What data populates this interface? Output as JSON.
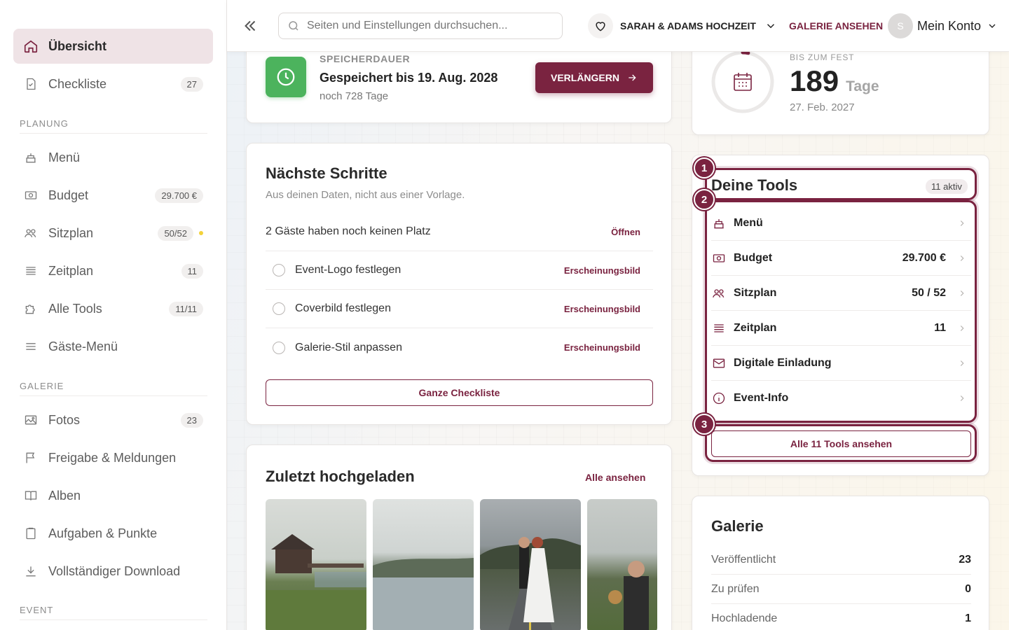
{
  "sidebar": {
    "items": [
      {
        "label": "Übersicht",
        "icon": "home-icon"
      },
      {
        "label": "Checkliste",
        "badge": "27",
        "icon": "checklist-icon"
      },
      {
        "label": "Menü",
        "icon": "cake-icon"
      },
      {
        "label": "Budget",
        "badge": "29.700 €",
        "icon": "money-icon"
      },
      {
        "label": "Sitzplan",
        "badge": "50/52",
        "icon": "people-icon"
      },
      {
        "label": "Zeitplan",
        "badge": "11",
        "icon": "timeline-icon"
      },
      {
        "label": "Alle Tools",
        "badge": "11/11",
        "icon": "puzzle-icon"
      },
      {
        "label": "Gäste-Menü",
        "icon": "menu-lines-icon"
      },
      {
        "label": "Fotos",
        "badge": "23",
        "icon": "image-icon"
      },
      {
        "label": "Freigabe & Meldungen",
        "icon": "flag-icon"
      },
      {
        "label": "Alben",
        "icon": "book-icon"
      },
      {
        "label": "Aufgaben & Punkte",
        "icon": "clipboard-icon"
      },
      {
        "label": "Vollständiger Download",
        "icon": "download-icon"
      }
    ],
    "sections": {
      "planung": "PLANUNG",
      "galerie": "GALERIE",
      "event": "EVENT"
    }
  },
  "topbar": {
    "search_placeholder": "Seiten und Einstellungen durchsuchen...",
    "event_name": "SARAH & ADAMS HOCHZEIT",
    "gallery_link": "GALERIE ANSEHEN",
    "avatar_initial": "S",
    "account_label": "Mein Konto"
  },
  "storage": {
    "label": "SPEICHERDAUER",
    "title": "Gespeichert bis 19. Aug. 2028",
    "subtitle": "noch 728 Tage",
    "button": "VERLÄNGERN"
  },
  "countdown": {
    "label": "BIS ZUM FEST",
    "days": "189",
    "unit": "Tage",
    "date": "27. Feb. 2027",
    "progress": 0.03
  },
  "next_steps": {
    "title": "Nächste Schritte",
    "subtitle": "Aus deinen Daten, nicht aus einer Vorlage.",
    "alert": {
      "text": "2 Gäste haben noch keinen Platz",
      "action": "Öffnen"
    },
    "items": [
      {
        "text": "Event-Logo festlegen",
        "tag": "Erscheinungsbild"
      },
      {
        "text": "Coverbild festlegen",
        "tag": "Erscheinungsbild"
      },
      {
        "text": "Galerie-Stil anpassen",
        "tag": "Erscheinungsbild"
      }
    ],
    "button": "Ganze Checkliste"
  },
  "recent": {
    "title": "Zuletzt hochgeladen",
    "link": "Alle ansehen"
  },
  "tools": {
    "title": "Deine Tools",
    "badge": "11 aktiv",
    "items": [
      {
        "label": "Menü",
        "value": "",
        "icon": "cake-icon"
      },
      {
        "label": "Budget",
        "value": "29.700 €",
        "icon": "money-icon"
      },
      {
        "label": "Sitzplan",
        "value": "50 / 52",
        "icon": "people-icon"
      },
      {
        "label": "Zeitplan",
        "value": "11",
        "icon": "timeline-icon"
      },
      {
        "label": "Digitale Einladung",
        "value": "",
        "icon": "envelope-icon"
      },
      {
        "label": "Event-Info",
        "value": "",
        "icon": "info-icon"
      }
    ],
    "button": "Alle 11 Tools ansehen",
    "markers": [
      "1",
      "2",
      "3"
    ]
  },
  "gallery": {
    "title": "Galerie",
    "stats": [
      {
        "label": "Veröffentlicht",
        "value": "23"
      },
      {
        "label": "Zu prüfen",
        "value": "0"
      },
      {
        "label": "Hochladende",
        "value": "1"
      }
    ]
  },
  "colors": {
    "accent": "#7a2340",
    "success": "#4cb35d",
    "active_bg": "#efe3e6"
  }
}
